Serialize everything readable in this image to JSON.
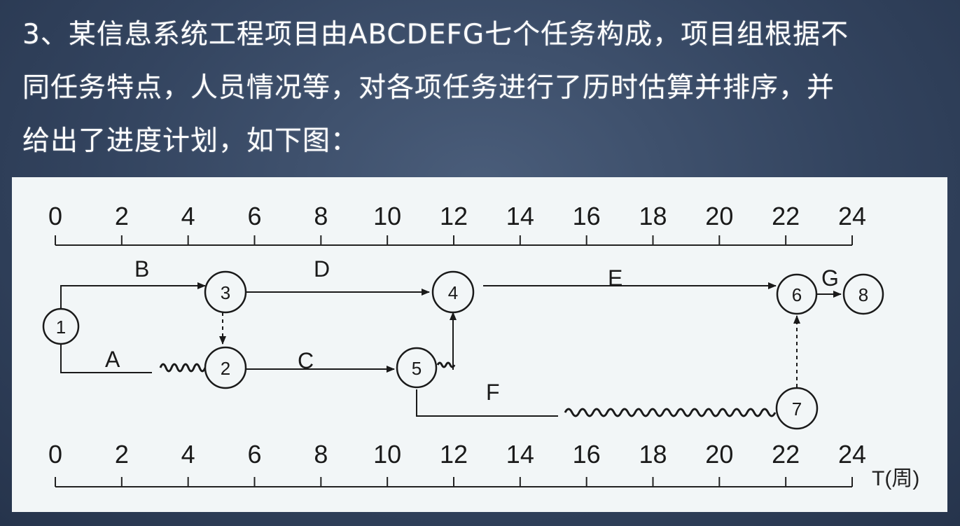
{
  "question": {
    "lines": [
      "3、某信息系统工程项目由ABCDEFG七个任务构成，项目组根据不",
      "同任务特点，人员情况等，对各项任务进行了历时估算并排序，并",
      "给出了进度计划，如下图："
    ]
  },
  "timescale": {
    "ticks": [
      "0",
      "2",
      "4",
      "6",
      "8",
      "10",
      "12",
      "14",
      "16",
      "18",
      "20",
      "22",
      "24"
    ],
    "unit_label": "T(周)"
  },
  "nodes": [
    "1",
    "2",
    "3",
    "4",
    "5",
    "6",
    "7",
    "8"
  ],
  "activities": {
    "A": "A",
    "B": "B",
    "C": "C",
    "D": "D",
    "E": "E",
    "F": "F",
    "G": "G"
  }
}
